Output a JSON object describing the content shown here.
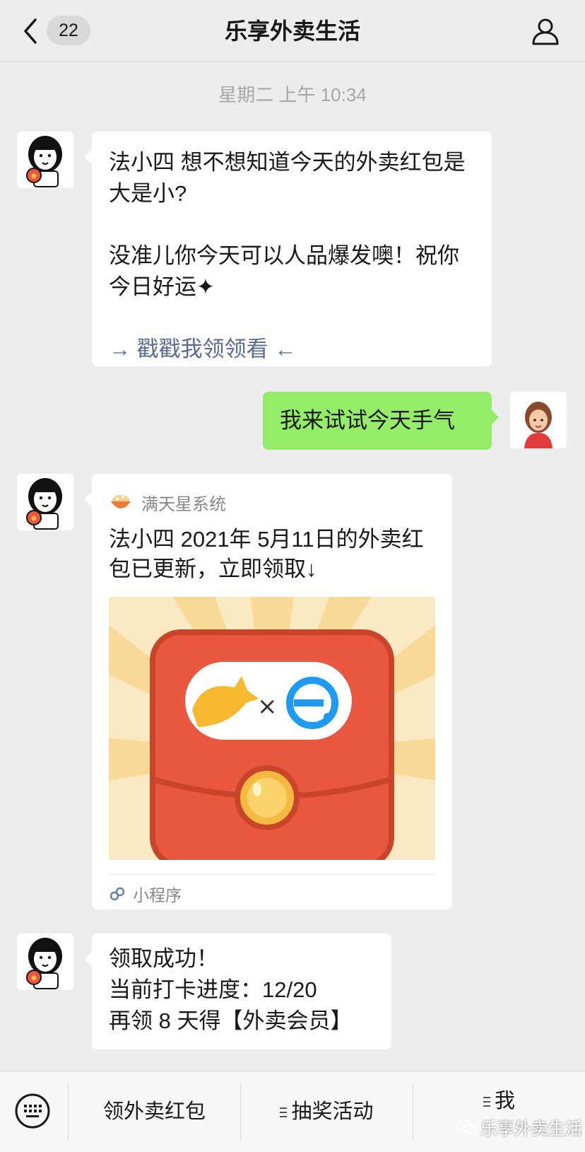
{
  "header": {
    "title": "乐享外卖生活",
    "unread_count": "22"
  },
  "timestamp": "星期二 上午 10:34",
  "messages": {
    "m1": {
      "line1": "法小四 想不想知道今天的外卖红包是大是小?",
      "line2": "没准儿你今天可以人品爆发噢！祝你今日好运✦",
      "link": "→ 戳戳我领领看 ←"
    },
    "m2": {
      "text": "我来试试今天手气"
    },
    "m3": {
      "source": "满天星系统",
      "text": "法小四 2021年 5月11日的外卖红包已更新，立即领取↓",
      "footer": "小程序"
    },
    "m4": {
      "line1": "领取成功！",
      "line2": "当前打卡进度：12/20",
      "line3": "再领 8 天得【外卖会员】"
    }
  },
  "menu": {
    "item1": "领外卖红包",
    "item2": "抽奖活动",
    "item3": "我"
  },
  "watermark": "乐享外卖生活",
  "colors": {
    "background": "#ededed",
    "bubble_user": "#95ec69",
    "bubble_bot": "#ffffff",
    "link": "#576b95",
    "envelope_red": "#e9573f"
  }
}
